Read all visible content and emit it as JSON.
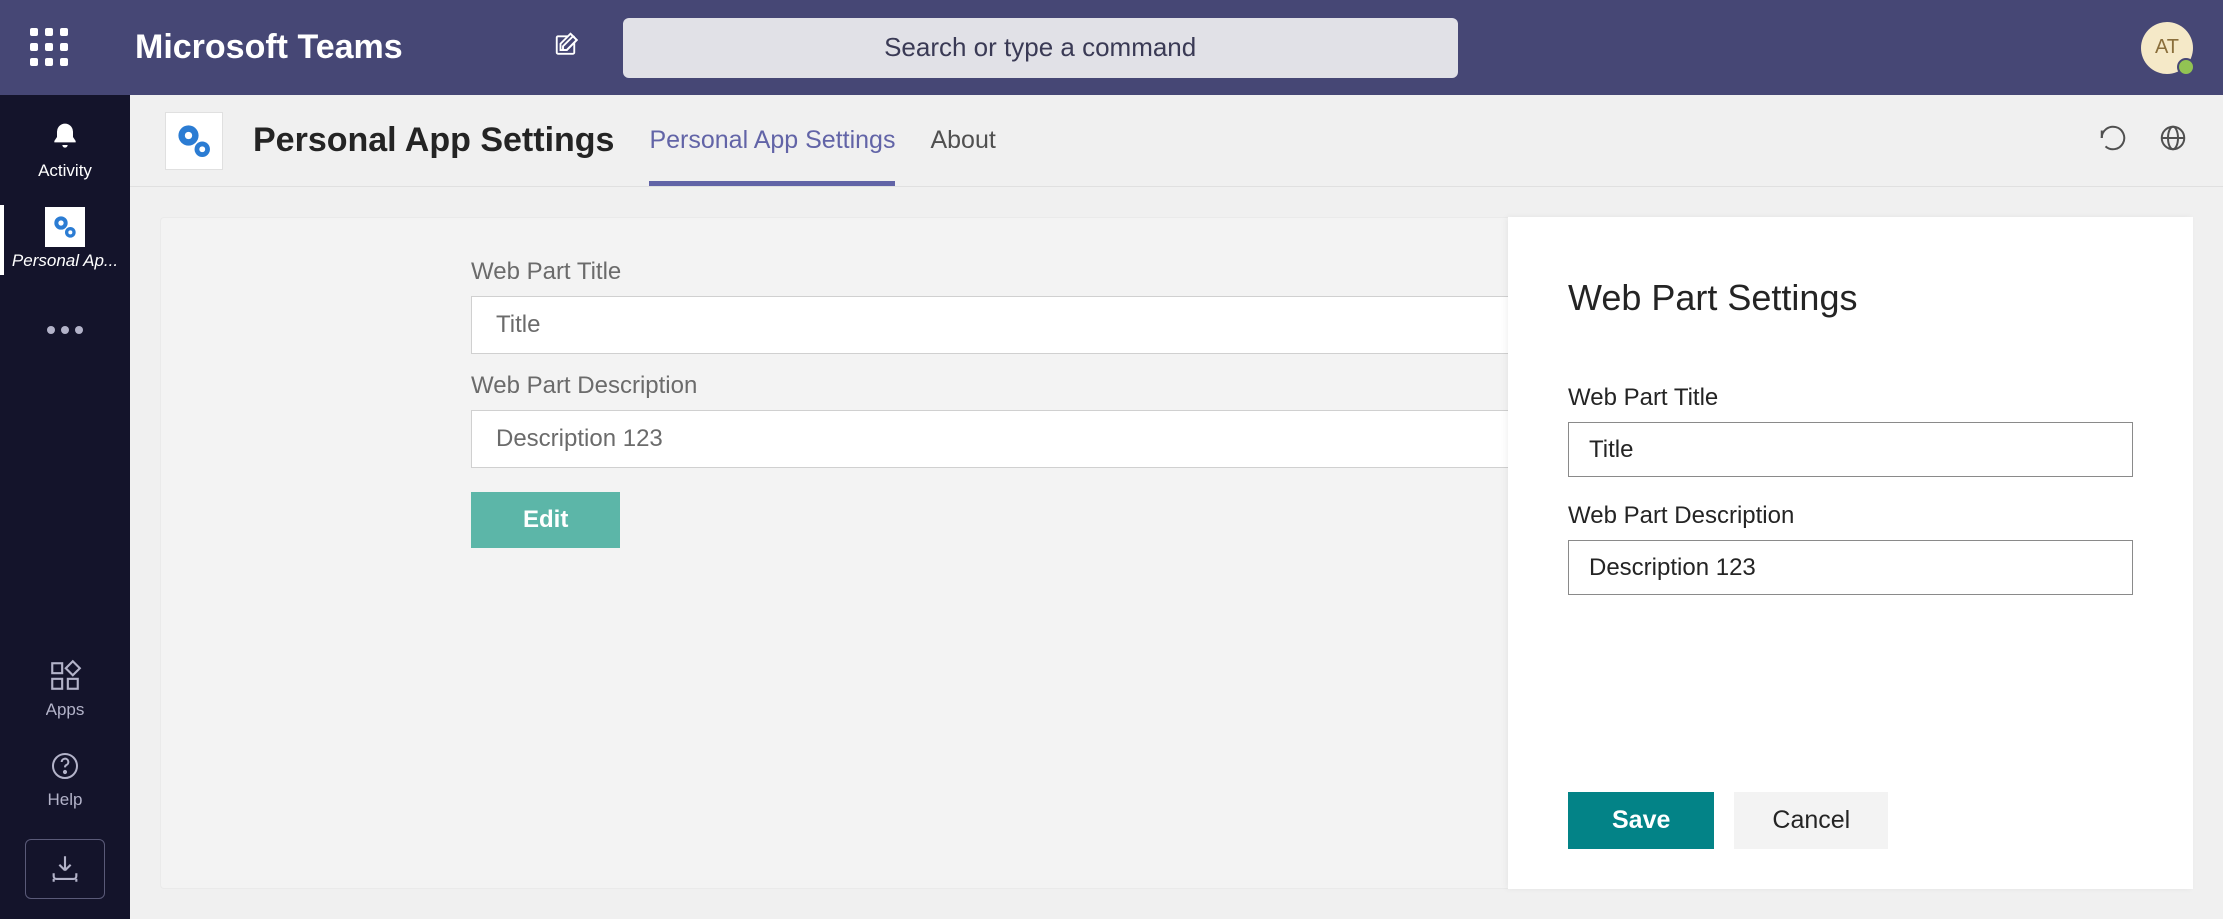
{
  "header": {
    "app_title": "Microsoft Teams",
    "search_placeholder": "Search or type a command",
    "avatar_initials": "AT"
  },
  "left_rail": {
    "activity_label": "Activity",
    "personal_app_label": "Personal Ap...",
    "apps_label": "Apps",
    "help_label": "Help"
  },
  "content": {
    "title": "Personal App Settings",
    "tabs": {
      "settings": "Personal App Settings",
      "about": "About"
    },
    "form": {
      "title_label": "Web Part Title",
      "title_value": "Title",
      "description_label": "Web Part Description",
      "description_value": "Description 123",
      "edit_button": "Edit"
    }
  },
  "panel": {
    "title": "Web Part Settings",
    "title_label": "Web Part Title",
    "title_value": "Title",
    "description_label": "Web Part Description",
    "description_value": "Description 123",
    "save_button": "Save",
    "cancel_button": "Cancel"
  }
}
